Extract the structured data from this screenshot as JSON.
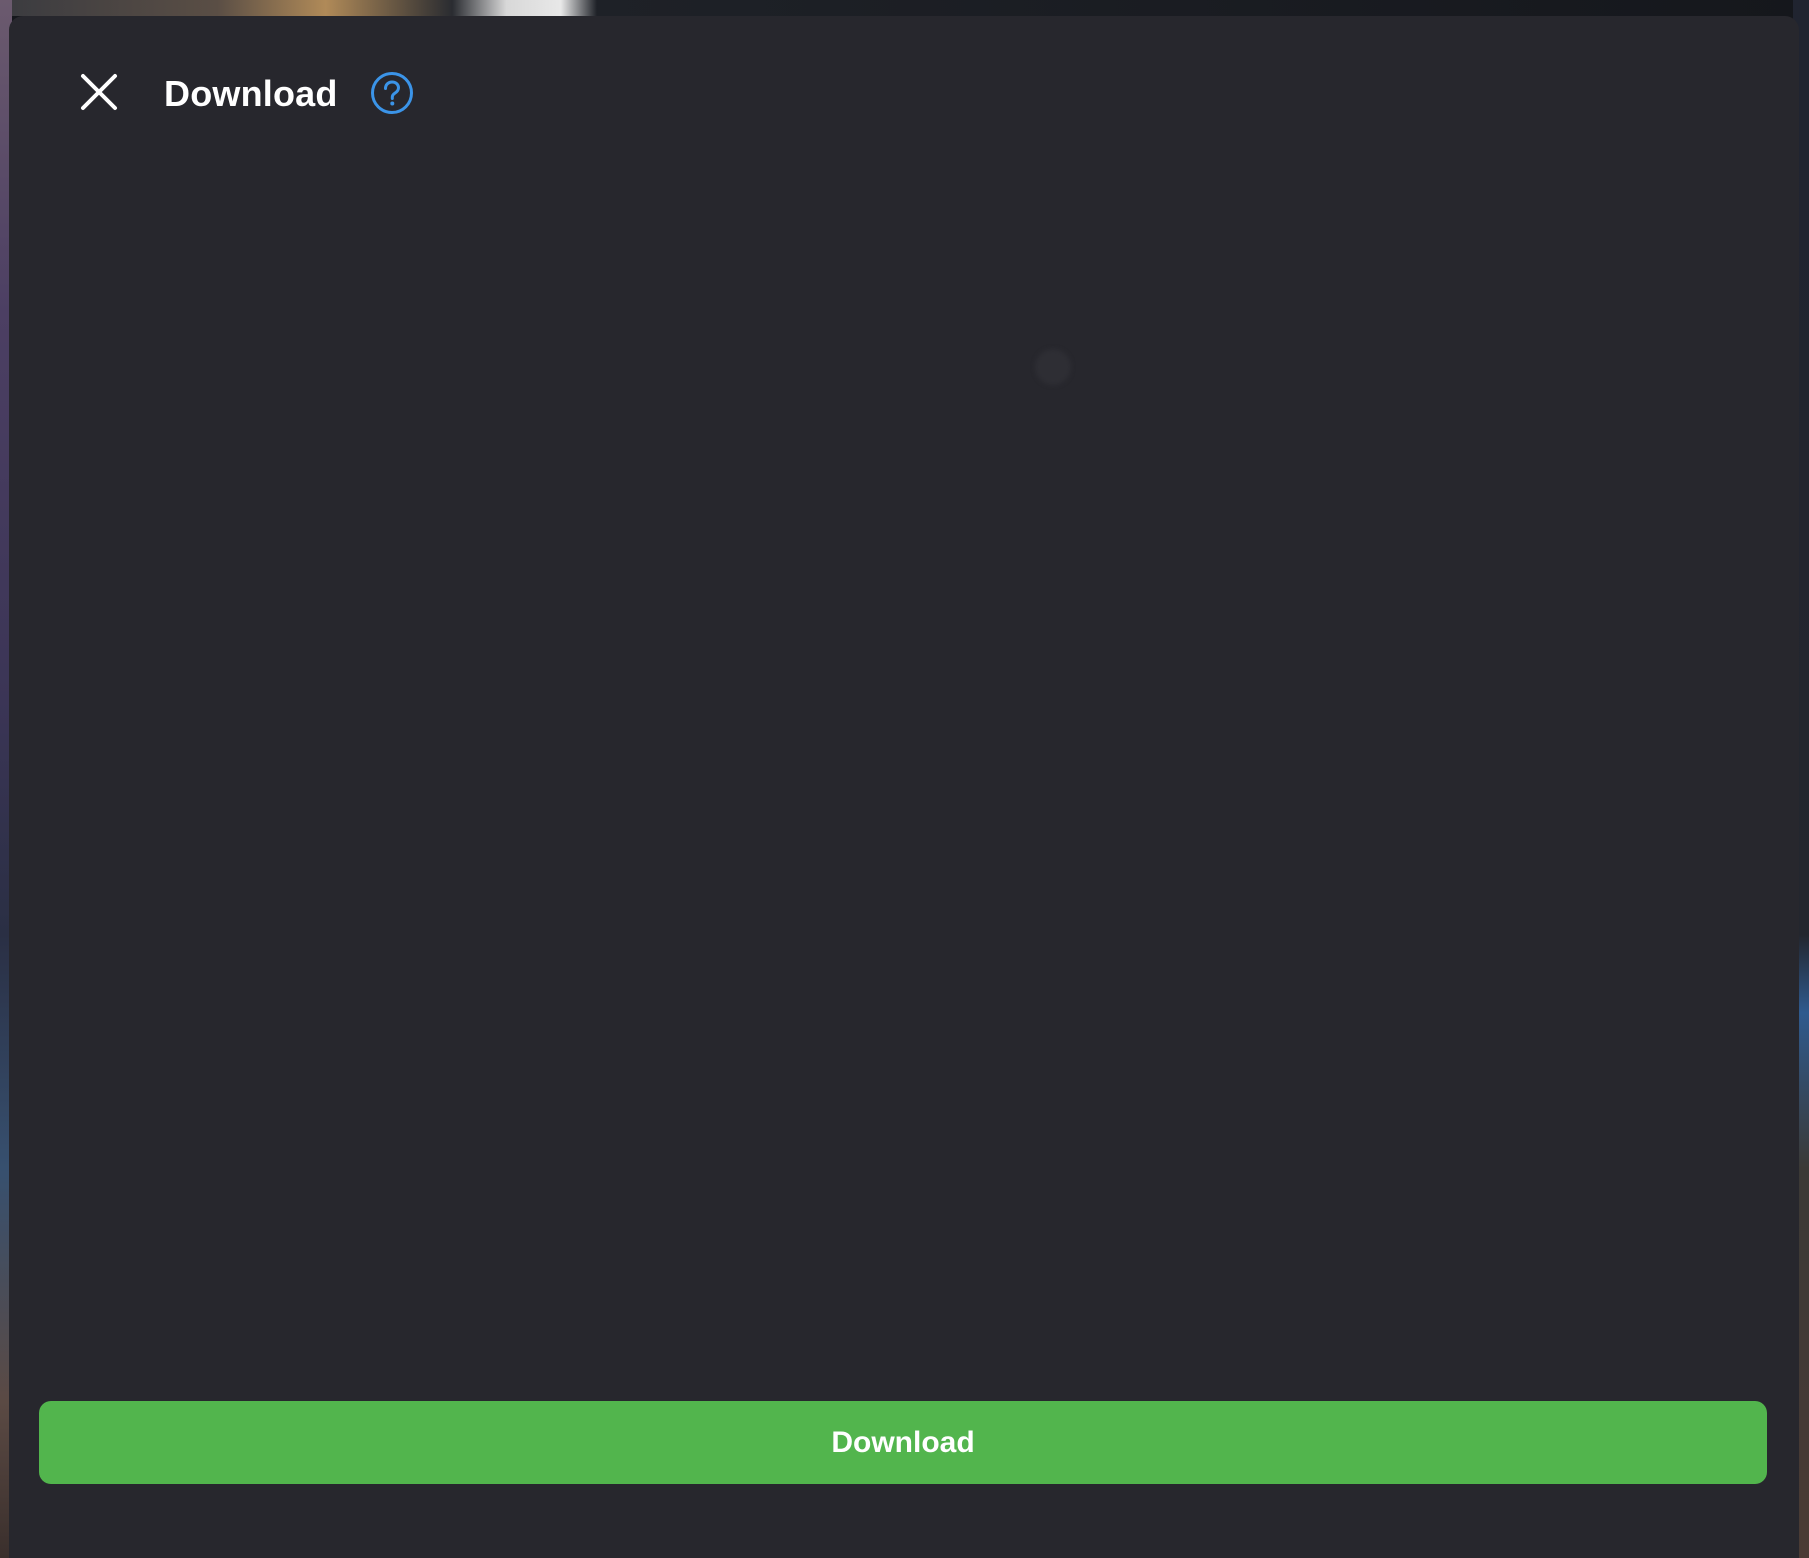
{
  "modal": {
    "title": "Download",
    "close_icon": "close-icon",
    "help_icon": "help-circle-icon",
    "primary_button_label": "Download"
  },
  "colors": {
    "modal_background": "#27272d",
    "primary_button": "#52b54d",
    "help_icon": "#3b94e8",
    "text": "#ffffff"
  }
}
